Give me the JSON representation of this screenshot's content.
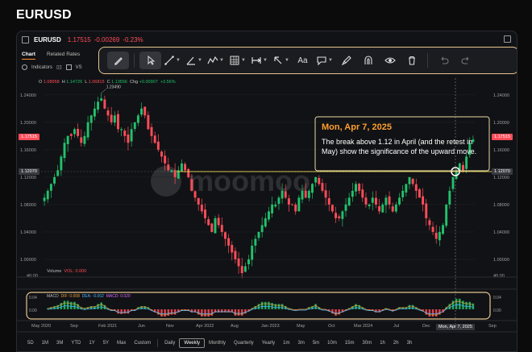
{
  "page_title": "EURUSD",
  "header": {
    "symbol": "EURUSD",
    "price": "1.17515",
    "change": "-0.00269",
    "change_pct": "-0.23%"
  },
  "tabs": [
    "Chart",
    "Related Rates"
  ],
  "left_tools": {
    "indicators": "Indicators",
    "vs": "VS"
  },
  "toolbar": {
    "items": [
      "pencil-icon",
      "cursor-icon",
      "line-icon",
      "angle-icon",
      "pattern-icon",
      "grid-icon",
      "range-icon",
      "arrow-icon",
      "text-icon",
      "comment-icon",
      "brush-icon",
      "magnet-icon",
      "eye-icon",
      "trash-icon",
      "undo-icon",
      "redo-icon"
    ],
    "text_tool_label": "Aa"
  },
  "ohlc": {
    "open_label": "O",
    "open": "1.08958",
    "high_label": "H",
    "high": "1.14726",
    "low_label": "L",
    "low": "1.06815",
    "close_label": "C",
    "close": "1.13556",
    "chg_label": "Chg",
    "chg": "+0.00907",
    "chg_pct": "+3.56%"
  },
  "annotation": {
    "date": "Mon, Apr 7, 2025",
    "text": "The break above 1.12 in April (and the retest in May) show the significance of the upward move."
  },
  "chart_data": {
    "type": "candlestick",
    "title": "EURUSD",
    "x_labels": [
      "May 2020",
      "Sep",
      "Feb 2021",
      "Jun",
      "Nov",
      "Apr 2022",
      "Aug",
      "Jan 2023",
      "May",
      "Oct",
      "Mar 2024",
      "Jul",
      "Dec",
      "Mon, Apr 7, 2025",
      "Sep"
    ],
    "y_ticks": [
      "1.24000",
      "1.20000",
      "1.16000",
      "1.12000",
      "1.08000",
      "1.04000",
      "1.00000"
    ],
    "ylim": [
      0.98,
      1.255
    ],
    "close_series": [
      1.09,
      1.1,
      1.11,
      1.12,
      1.13,
      1.15,
      1.17,
      1.18,
      1.18,
      1.19,
      1.18,
      1.17,
      1.18,
      1.2,
      1.21,
      1.22,
      1.23,
      1.2349,
      1.22,
      1.21,
      1.2,
      1.21,
      1.19,
      1.19,
      1.18,
      1.17,
      1.19,
      1.2,
      1.21,
      1.22,
      1.21,
      1.19,
      1.18,
      1.17,
      1.16,
      1.15,
      1.14,
      1.13,
      1.13,
      1.12,
      1.13,
      1.14,
      1.13,
      1.12,
      1.1,
      1.09,
      1.08,
      1.07,
      1.06,
      1.05,
      1.04,
      1.06,
      1.05,
      1.04,
      1.03,
      1.02,
      1.01,
      1.0,
      0.99,
      0.98,
      0.99,
      1.0,
      1.02,
      1.03,
      1.04,
      1.05,
      1.06,
      1.07,
      1.08,
      1.08,
      1.09,
      1.1,
      1.09,
      1.08,
      1.08,
      1.07,
      1.09,
      1.1,
      1.09,
      1.1,
      1.11,
      1.12,
      1.11,
      1.1,
      1.09,
      1.08,
      1.07,
      1.06,
      1.06,
      1.07,
      1.08,
      1.09,
      1.1,
      1.11,
      1.1,
      1.09,
      1.08,
      1.08,
      1.09,
      1.08,
      1.07,
      1.08,
      1.09,
      1.08,
      1.07,
      1.08,
      1.09,
      1.1,
      1.11,
      1.12,
      1.11,
      1.1,
      1.09,
      1.08,
      1.06,
      1.05,
      1.04,
      1.03,
      1.04,
      1.05,
      1.08,
      1.1,
      1.12,
      1.13,
      1.14,
      1.13,
      1.15,
      1.17,
      1.175
    ],
    "current_price": "1.17515",
    "crosshair_price": "1.12070",
    "peak_label": "1.23490",
    "volume_label": "Volume",
    "volume_value": "VOL: 0.000",
    "volume_axis": "40.00",
    "macd": {
      "label": "MACD",
      "dif": "DIF: 0.008",
      "dea": "DEA: -0.002",
      "macd": "MACD: 0.020",
      "y_ticks": [
        "0.04",
        "0.00"
      ]
    }
  },
  "bottom_bar": {
    "ranges": [
      "5D",
      "1M",
      "3M",
      "YTD",
      "1Y",
      "5Y",
      "Max",
      "Custom"
    ],
    "intervals": [
      "Daily",
      "Weekly",
      "Monthly",
      "Quarterly",
      "Yearly",
      "1m",
      "3m",
      "5m",
      "10m",
      "15m",
      "30m",
      "1h",
      "2h",
      "3h"
    ],
    "selected": "Weekly"
  },
  "colors": {
    "up": "#21c16b",
    "down": "#ff4d5a",
    "accent": "#ff9f2f",
    "highlight_border": "#e6c58f",
    "level_line": "#e8d24a"
  }
}
